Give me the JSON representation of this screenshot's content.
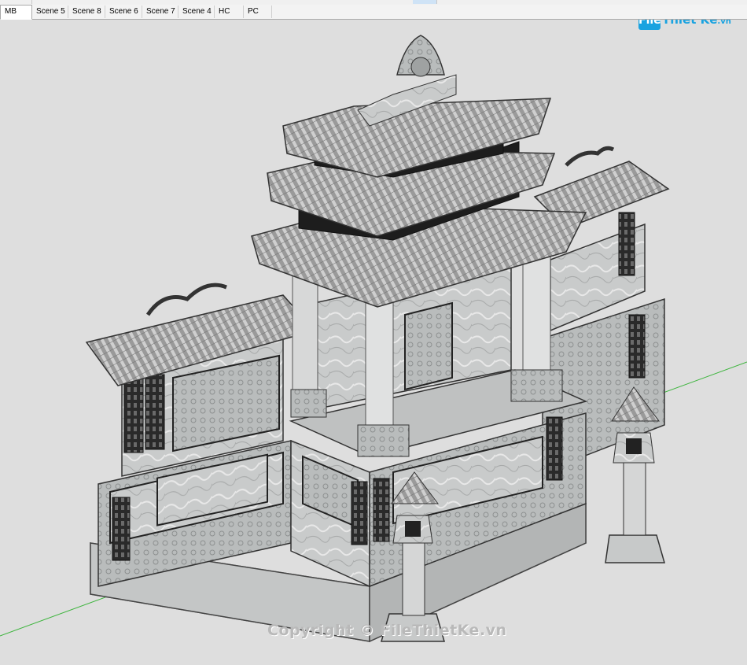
{
  "scene_tabs": [
    {
      "label": "MB",
      "active": true
    },
    {
      "label": "Scene 5"
    },
    {
      "label": "Scene 8"
    },
    {
      "label": "Scene 6"
    },
    {
      "label": "Scene 7"
    },
    {
      "label": "Scene 4"
    },
    {
      "label": "HC"
    },
    {
      "label": "PC"
    }
  ],
  "logo": {
    "mark": "File",
    "text": "Thiết Kế",
    "domain": ".vn"
  },
  "watermark": "Copyright © FileThietKe.vn",
  "colors": {
    "axis_green": "#3cb43c",
    "tab_bg": "#f3f3f3",
    "viewport_bg": "#dedede",
    "logo_blue": "#1aa3e0"
  }
}
